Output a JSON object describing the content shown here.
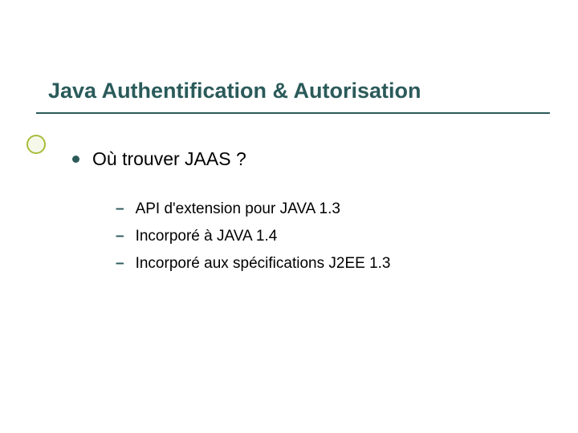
{
  "title": "Java Authentification & Autorisation",
  "bullet": "Où trouver JAAS ?",
  "subitems": [
    "API d'extension pour JAVA 1.3",
    "Incorporé à JAVA 1.4",
    "Incorporé aux spécifications J2EE 1.3"
  ]
}
